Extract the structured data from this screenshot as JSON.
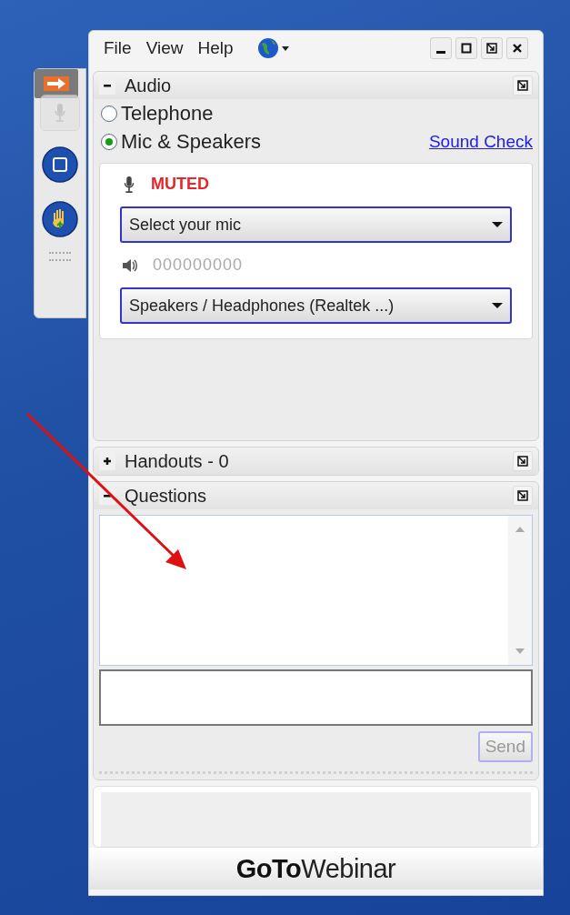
{
  "menu": [
    "File",
    "View",
    "Help"
  ],
  "toolbar": [
    {
      "kind": "arrow",
      "disabled": false
    },
    {
      "kind": "mic",
      "disabled": true
    },
    {
      "kind": "screen",
      "disabled": false
    },
    {
      "kind": "hand",
      "disabled": false
    }
  ],
  "audio": {
    "title": "Audio",
    "expanded": true,
    "options": [
      {
        "label": "Telephone",
        "selected": false
      },
      {
        "label": "Mic & Speakers",
        "selected": true
      }
    ],
    "sound_check": "Sound Check",
    "mic_status": "MUTED",
    "mic_select": "Select your mic",
    "level_meter": "000000000",
    "speaker_select": "Speakers / Headphones (Realtek ...)"
  },
  "handouts": {
    "title": "Handouts - 0",
    "expanded": false
  },
  "questions": {
    "title": "Questions",
    "expanded": true,
    "send": "Send",
    "send_disabled": true
  },
  "logo": "**GoTo**Webinar"
}
